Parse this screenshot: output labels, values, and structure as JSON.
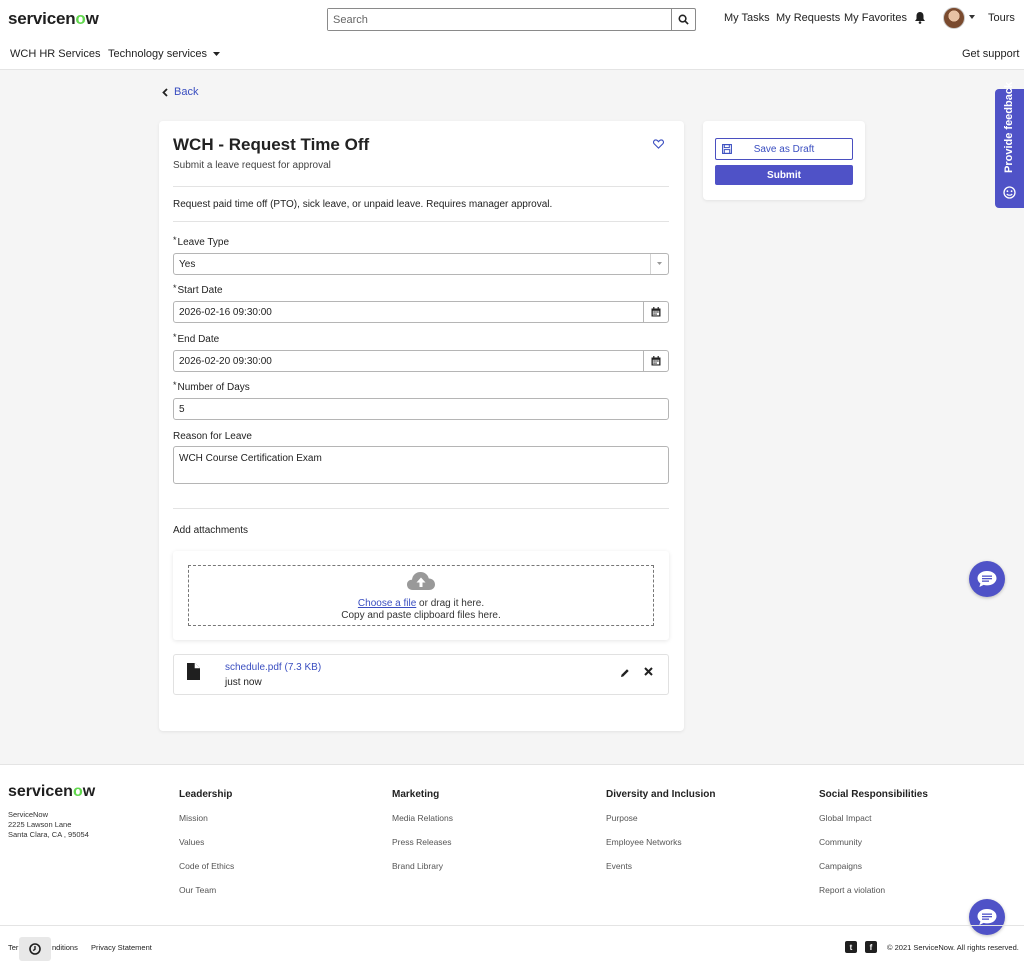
{
  "header": {
    "brand": "servicen",
    "brand_o": "o",
    "brand_end": "w",
    "search_placeholder": "Search",
    "links": [
      "My Tasks",
      "My Requests",
      "My Favorites"
    ],
    "tours": "Tours"
  },
  "nav": {
    "hr_services": "WCH HR Services",
    "tech_services": "Technology services",
    "get_support": "Get support"
  },
  "back_label": "Back",
  "form": {
    "title": "WCH - Request Time Off",
    "subtitle": "Submit a leave request for approval",
    "description": "Request paid time off (PTO), sick leave, or unpaid leave. Requires manager approval.",
    "required_mark": "*",
    "fields": {
      "leave_type": {
        "label": "Leave Type",
        "value": "Yes"
      },
      "start_date": {
        "label": "Start Date",
        "value": "2026-02-16 09:30:00"
      },
      "end_date": {
        "label": "End Date",
        "value": "2026-02-20 09:30:00"
      },
      "num_days": {
        "label": "Number of Days",
        "value": "5"
      },
      "reason": {
        "label": "Reason for Leave",
        "value": "WCH Course Certification Exam"
      }
    },
    "attachments_label": "Add attachments",
    "dropzone": {
      "choose": "Choose a file",
      "drag": " or drag it here.",
      "paste": "Copy and paste clipboard files here."
    },
    "file": {
      "name": "schedule.pdf (7.3 KB)",
      "time": "just now"
    }
  },
  "actions": {
    "save_draft": "Save as Draft",
    "submit": "Submit"
  },
  "feedback_label": "Provide feedback",
  "footer": {
    "brand": "servicen",
    "brand_o": "o",
    "brand_end": "w",
    "address": [
      "ServiceNow",
      "2225 Lawson Lane",
      "Santa Clara, CA , 95054"
    ],
    "columns": [
      {
        "heading": "Leadership",
        "items": [
          "Mission",
          "Values",
          "Code of Ethics",
          "Our Team"
        ]
      },
      {
        "heading": "Marketing",
        "items": [
          "Media Relations",
          "Press Releases",
          "Brand Library"
        ]
      },
      {
        "heading": "Diversity and Inclusion",
        "items": [
          "Purpose",
          "Employee Networks",
          "Events"
        ]
      },
      {
        "heading": "Social Responsibilities",
        "items": [
          "Global Impact",
          "Community",
          "Campaigns",
          "Report a violation"
        ]
      }
    ],
    "terms_prefix": "Ter",
    "terms_suffix": "nditions",
    "privacy": "Privacy Statement",
    "copyright": "© 2021 ServiceNow. All rights reserved."
  },
  "colors": {
    "accent": "#4f52c7",
    "link": "#3a4ec0",
    "brand_green": "#62d84e"
  }
}
